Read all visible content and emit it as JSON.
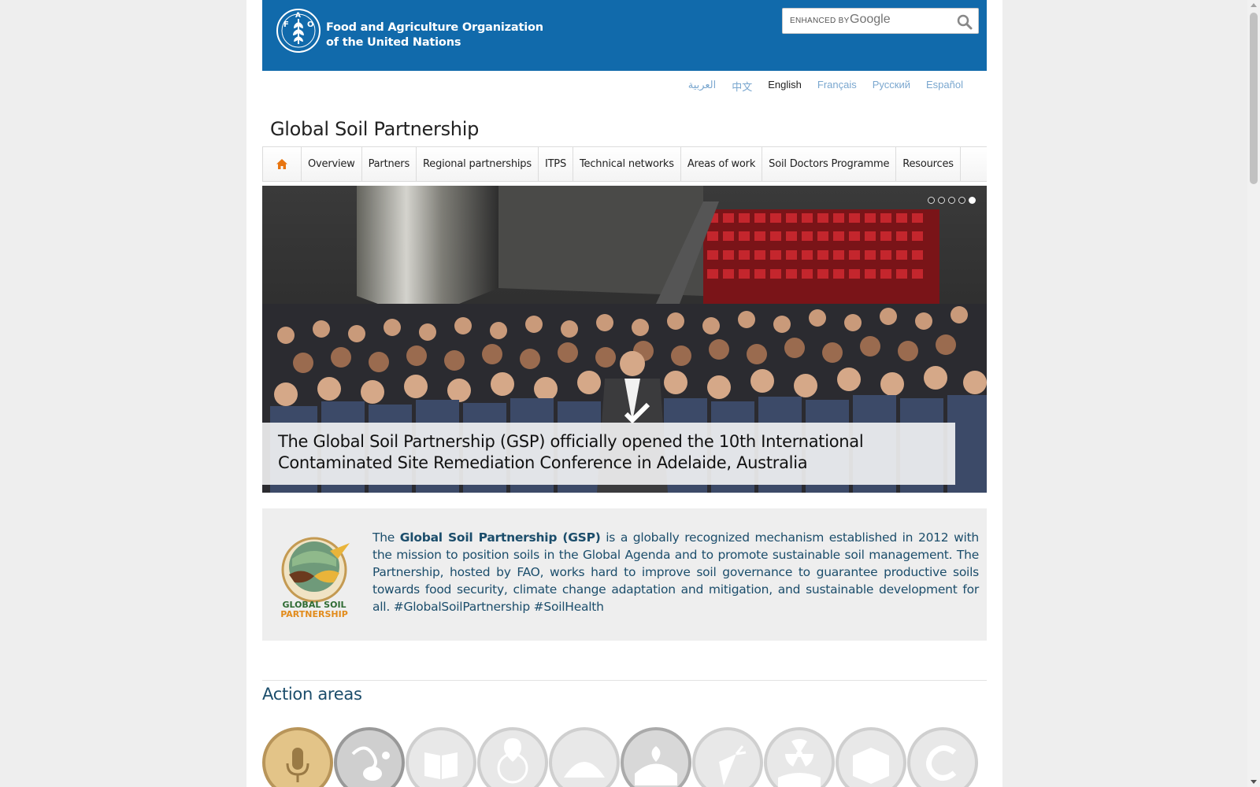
{
  "header": {
    "org_line1": "Food and Agriculture Organization",
    "org_line2": "of the United Nations",
    "search": {
      "enhanced_label": "ENHANCED BY",
      "provider": "Google"
    }
  },
  "languages": [
    {
      "label": "العربية",
      "active": false
    },
    {
      "label": "中文",
      "active": false
    },
    {
      "label": "English",
      "active": true
    },
    {
      "label": "Français",
      "active": false
    },
    {
      "label": "Русский",
      "active": false
    },
    {
      "label": "Español",
      "active": false
    }
  ],
  "site_title": "Global Soil Partnership",
  "nav": {
    "home_icon": "home-icon",
    "items": [
      "Overview",
      "Partners",
      "Regional partnerships",
      "ITPS",
      "Technical networks",
      "Areas of work",
      "Soil Doctors Programme",
      "Resources"
    ]
  },
  "slider": {
    "slide_count": 5,
    "active_index": 4,
    "caption": "The Global Soil Partnership (GSP) officially opened the 10th International Contaminated Site Remediation Conference in Adelaide, Australia"
  },
  "intro": {
    "logo_text_line1": "GLOBAL SOIL",
    "logo_text_line2": "PARTNERSHIP",
    "pre": "The ",
    "bold": "Global Soil Partnership (GSP)",
    "post": " is a globally recognized mechanism established in 2012 with the mission to position soils in the Global Agenda and to promote sustainable soil management. The Partnership, hosted by FAO, works hard to improve soil governance to guarantee productive soils towards food security, climate change adaptation and mitigation, and sustainable development for all.  #GlobalSoilPartnership #SoilHealth"
  },
  "action_areas": {
    "title": "Action areas",
    "icons": [
      "microphone-icon",
      "soil-organisms-icon",
      "book-icon",
      "globe-pin-icon",
      "soil-particles-icon",
      "plant-soil-icon",
      "carrot-icon",
      "radioactive-soil-icon",
      "soil-block-icon",
      "letter-c-icon"
    ]
  },
  "colors": {
    "header_blue": "#116aab",
    "accent_orange": "#e87511",
    "text_navy": "#1b4d6b"
  }
}
